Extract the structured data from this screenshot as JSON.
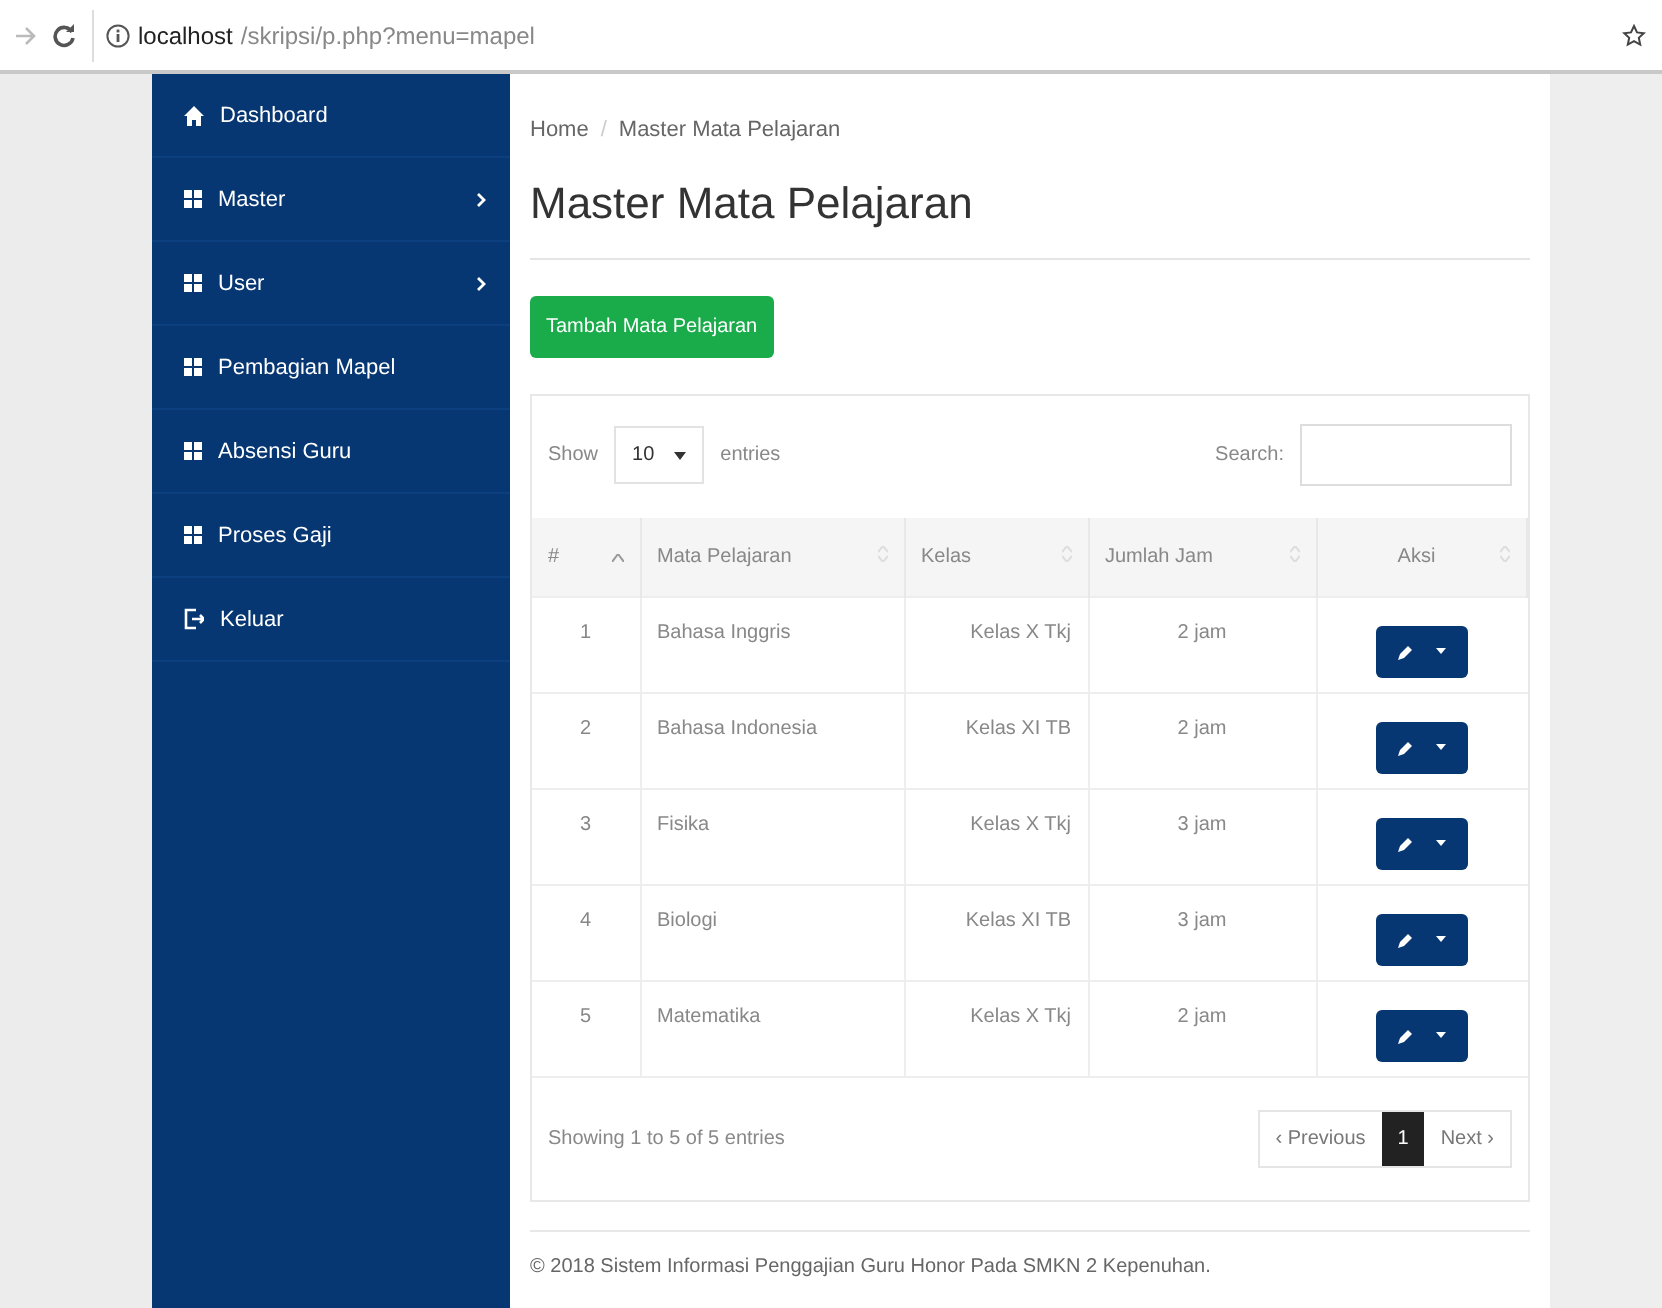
{
  "browser": {
    "url_host": "localhost",
    "url_path": "/skripsi/p.php?menu=mapel"
  },
  "sidebar": {
    "items": [
      {
        "label": "Dashboard",
        "kind": "home",
        "has_submenu": false
      },
      {
        "label": "Master",
        "kind": "menu",
        "has_submenu": true
      },
      {
        "label": "User",
        "kind": "menu",
        "has_submenu": true
      },
      {
        "label": "Pembagian Mapel",
        "kind": "menu",
        "has_submenu": false
      },
      {
        "label": "Absensi Guru",
        "kind": "menu",
        "has_submenu": false
      },
      {
        "label": "Proses Gaji",
        "kind": "menu",
        "has_submenu": false
      },
      {
        "label": "Keluar",
        "kind": "logout",
        "has_submenu": false
      }
    ]
  },
  "breadcrumb": [
    "Home",
    "Master Mata Pelajaran"
  ],
  "breadcrumb_separator": "/",
  "page_title": "Master Mata Pelajaran",
  "add_button": "Tambah Mata Pelajaran",
  "table": {
    "length_label_before": "Show",
    "length_value": "10",
    "length_label_after": "entries",
    "search_label": "Search:",
    "columns": [
      {
        "label": "#",
        "sorted": true
      },
      {
        "label": "Mata Pelajaran",
        "sorted": false
      },
      {
        "label": "Kelas",
        "sorted": false
      },
      {
        "label": "Jumlah Jam",
        "sorted": false
      },
      {
        "label": "Aksi",
        "sorted": false
      }
    ],
    "rows": [
      {
        "no": "1",
        "mapel": "Bahasa Inggris",
        "kelas": "Kelas X Tkj",
        "jam": "2 jam"
      },
      {
        "no": "2",
        "mapel": "Bahasa Indonesia",
        "kelas": "Kelas XI TB",
        "jam": "2 jam"
      },
      {
        "no": "3",
        "mapel": "Fisika",
        "kelas": "Kelas X Tkj",
        "jam": "3 jam"
      },
      {
        "no": "4",
        "mapel": "Biologi",
        "kelas": "Kelas XI TB",
        "jam": "3 jam"
      },
      {
        "no": "5",
        "mapel": "Matematika",
        "kelas": "Kelas X Tkj",
        "jam": "2 jam"
      }
    ],
    "info": "Showing 1 to 5 of 5 entries",
    "pagination": [
      {
        "label": "‹ Previous",
        "selected": false
      },
      {
        "label": "1",
        "selected": true
      },
      {
        "label": "Next ›",
        "selected": false
      }
    ]
  },
  "footer": "© 2018 Sistem Informasi Penggajian Guru Honor Pada SMKN 2 Kepenuhan."
}
